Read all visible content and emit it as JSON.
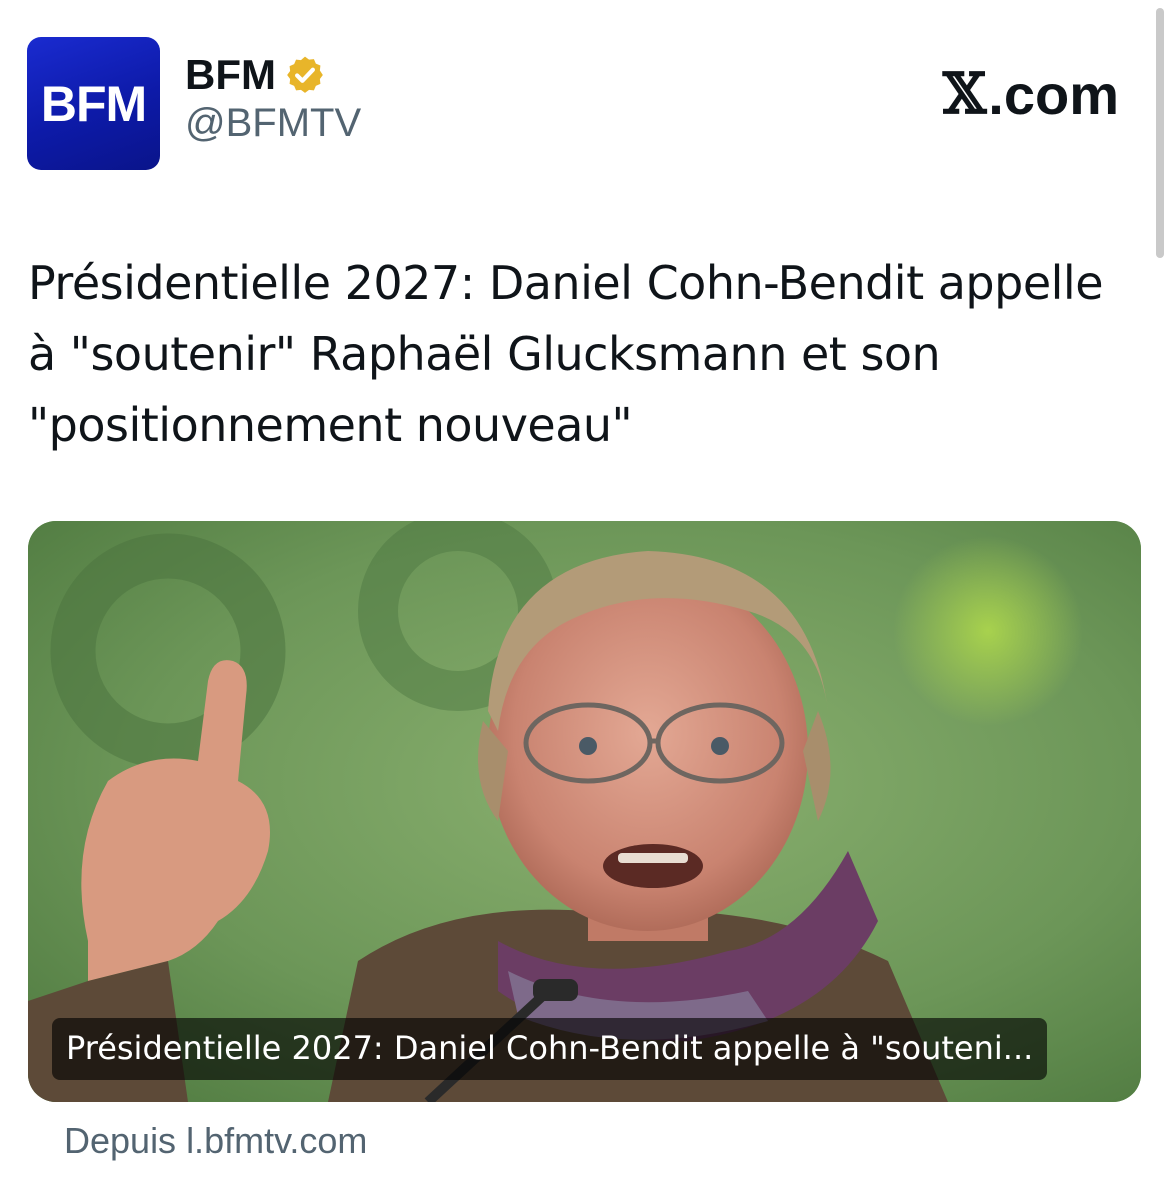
{
  "account": {
    "avatar_text": "BFM",
    "display_name": "BFM",
    "handle": "@BFMTV",
    "verified_icon": "verified-badge-gold"
  },
  "brand": {
    "site_glyph": "𝕏",
    "site_suffix": ".com"
  },
  "tweet": {
    "headline": "Présidentielle 2027: Daniel Cohn-Bendit appelle à \"soutenir\" Raphaël Glucksmann et son \"positionnement nouveau\""
  },
  "card": {
    "caption": "Présidentielle 2027: Daniel Cohn-Bendit appelle à \"souteni...",
    "source": "Depuis l.bfmtv.com"
  },
  "colors": {
    "avatar_bg": "#1a2bd0",
    "badge_gold": "#e8b52a",
    "secondary_text": "#536471",
    "photo_bg": "#6e9a5a"
  }
}
